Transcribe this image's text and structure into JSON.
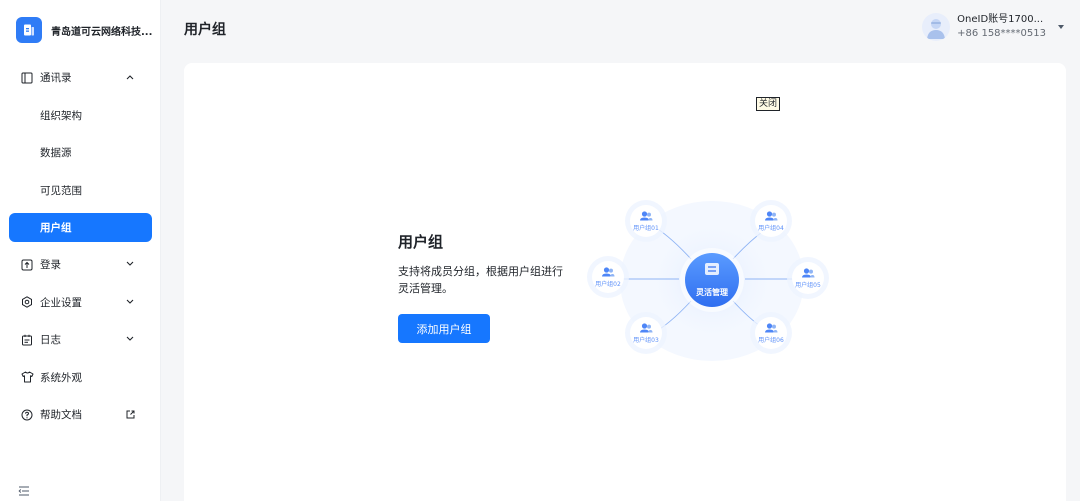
{
  "org": {
    "name": "青岛道可云网络科技..."
  },
  "sidebar": {
    "items": [
      {
        "label": "通讯录",
        "icon": "contacts-icon"
      },
      {
        "label": "组织架构"
      },
      {
        "label": "数据源"
      },
      {
        "label": "可见范围"
      },
      {
        "label": "用户组"
      },
      {
        "label": "登录",
        "icon": "login-icon"
      },
      {
        "label": "企业设置",
        "icon": "settings-icon"
      },
      {
        "label": "日志",
        "icon": "log-icon"
      },
      {
        "label": "系统外观",
        "icon": "shirt-icon"
      },
      {
        "label": "帮助文档",
        "icon": "help-icon"
      }
    ]
  },
  "header": {
    "title": "用户组",
    "user": {
      "name": "OneID账号1700...",
      "phone": "+86 158****0513"
    }
  },
  "main": {
    "close_label": "关闭",
    "intro": {
      "title": "用户组",
      "description": "支持将成员分组，根据用户组进行灵活管理。",
      "button_label": "添加用户组"
    },
    "diagram": {
      "center_label": "灵活管理",
      "groups": [
        "用户组01",
        "用户组02",
        "用户组03",
        "用户组04",
        "用户组05",
        "用户组06"
      ]
    }
  },
  "colors": {
    "accent": "#1677ff",
    "sidebar_bg": "#ffffff",
    "page_bg": "#f5f6f8"
  }
}
